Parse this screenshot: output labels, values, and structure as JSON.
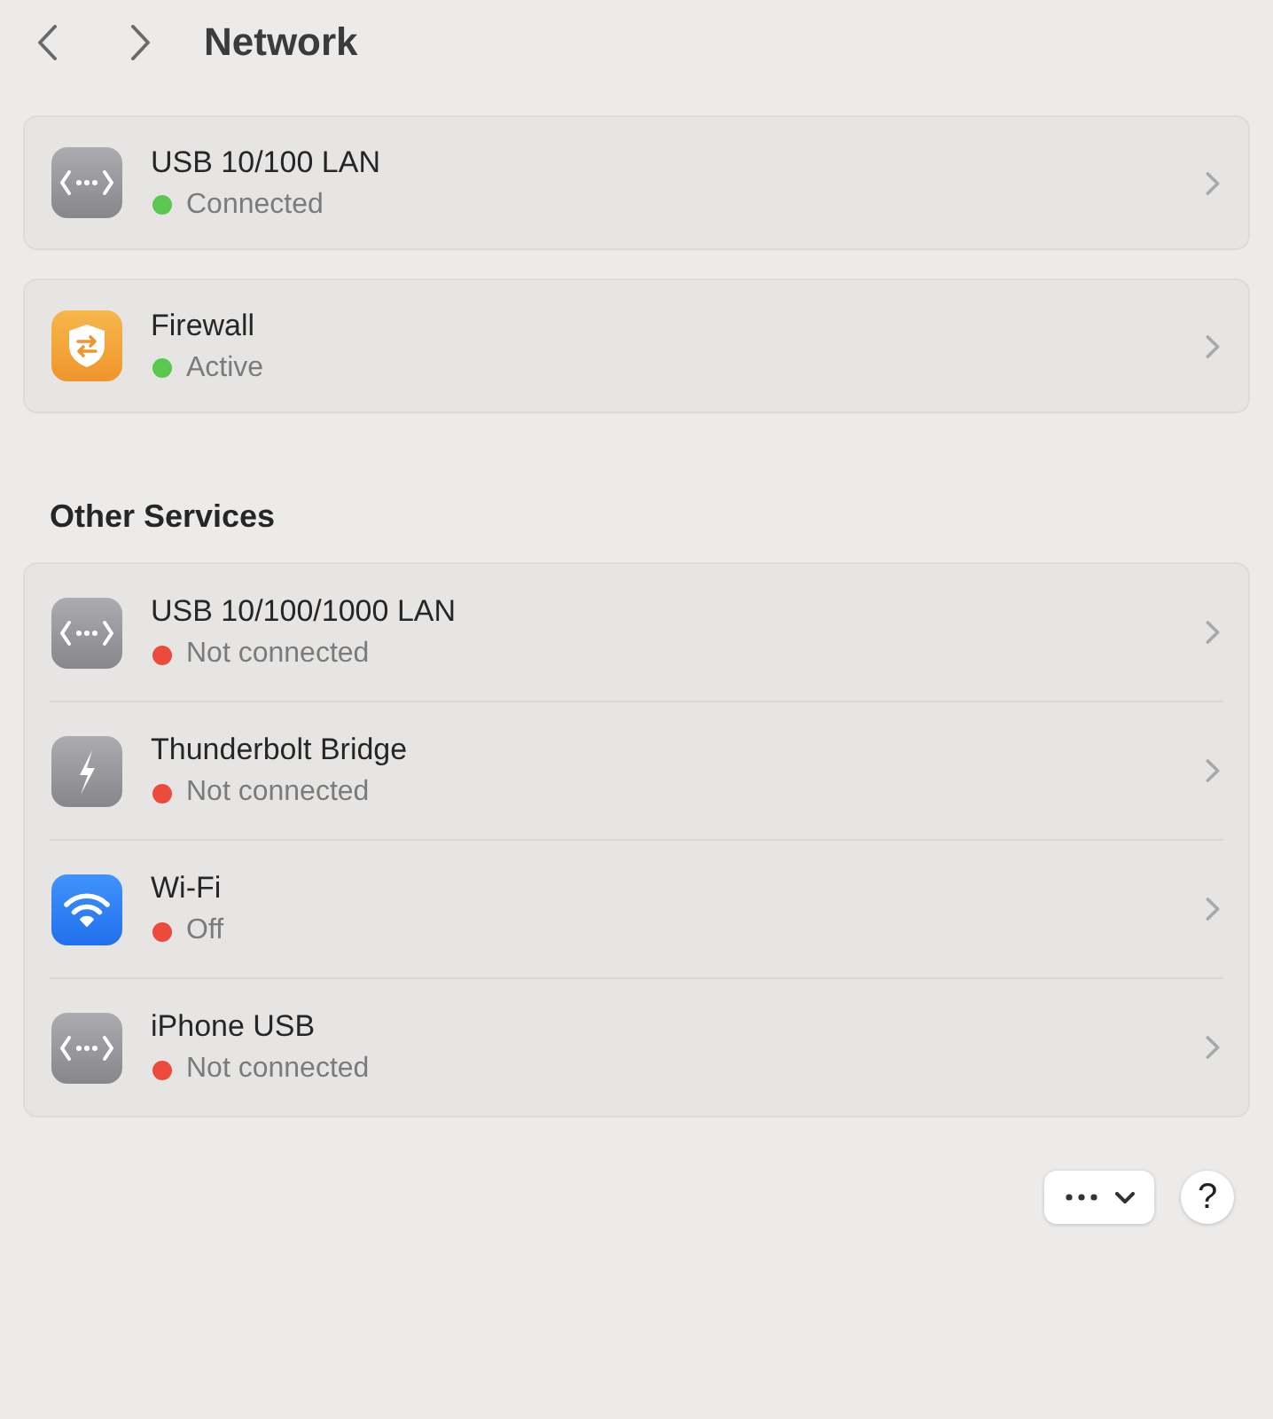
{
  "window": {
    "title": "Network"
  },
  "services": [
    {
      "kind": "ethernet",
      "name": "USB 10/100 LAN",
      "status": "Connected",
      "color": "#5ac84e"
    },
    {
      "kind": "firewall",
      "name": "Firewall",
      "status": "Active",
      "color": "#5ac84e"
    }
  ],
  "other_services": {
    "title": "Other Services",
    "items": [
      {
        "kind": "ethernet",
        "name": "USB 10/100/1000 LAN",
        "status": "Not connected",
        "color": "#ec4b3c"
      },
      {
        "kind": "thunderbolt",
        "name": "Thunderbolt Bridge",
        "status": "Not connected",
        "color": "#ec4b3c"
      },
      {
        "kind": "wifi",
        "name": "Wi-Fi",
        "status": "Off",
        "color": "#ec4b3c"
      },
      {
        "kind": "ethernet",
        "name": "iPhone USB",
        "status": "Not connected",
        "color": "#ec4b3c"
      }
    ]
  },
  "help_button": {
    "label": "?"
  }
}
